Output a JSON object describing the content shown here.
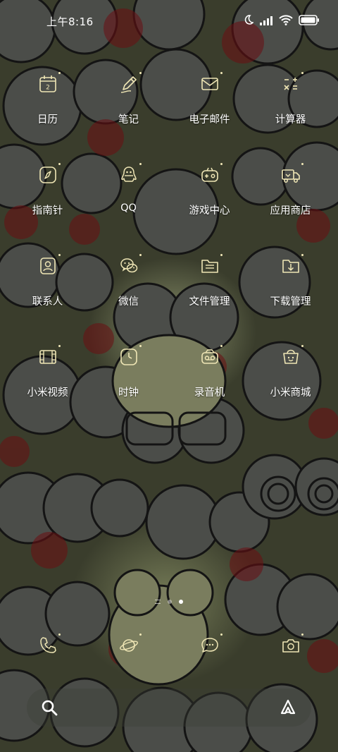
{
  "status": {
    "time": "上午8:16",
    "icons": [
      "moon-icon",
      "signal-icon",
      "wifi-icon",
      "battery-icon"
    ]
  },
  "apps": [
    [
      {
        "label": "日历",
        "icon": "calendar-icon",
        "badge": "2"
      },
      {
        "label": "笔记",
        "icon": "notes-icon"
      },
      {
        "label": "电子邮件",
        "icon": "email-icon"
      },
      {
        "label": "计算器",
        "icon": "calculator-icon"
      }
    ],
    [
      {
        "label": "指南针",
        "icon": "compass-icon"
      },
      {
        "label": "QQ",
        "icon": "qq-icon"
      },
      {
        "label": "游戏中心",
        "icon": "game-center-icon"
      },
      {
        "label": "应用商店",
        "icon": "app-store-icon"
      }
    ],
    [
      {
        "label": "联系人",
        "icon": "contacts-icon"
      },
      {
        "label": "微信",
        "icon": "wechat-icon"
      },
      {
        "label": "文件管理",
        "icon": "file-manager-icon"
      },
      {
        "label": "下载管理",
        "icon": "download-manager-icon"
      }
    ],
    [
      {
        "label": "小米视频",
        "icon": "video-icon"
      },
      {
        "label": "时钟",
        "icon": "clock-icon"
      },
      {
        "label": "录音机",
        "icon": "recorder-icon"
      },
      {
        "label": "小米商城",
        "icon": "mi-store-icon"
      }
    ]
  ],
  "dock": [
    "phone-icon",
    "browser-icon",
    "messages-icon",
    "camera-icon"
  ],
  "pages": {
    "count": 2,
    "active": 2
  },
  "search": {
    "icon": "search-icon",
    "assistant_icon": "assistant-icon"
  },
  "colors": {
    "icon_stroke": "#efe6b5",
    "background": "#3a3d2c"
  }
}
